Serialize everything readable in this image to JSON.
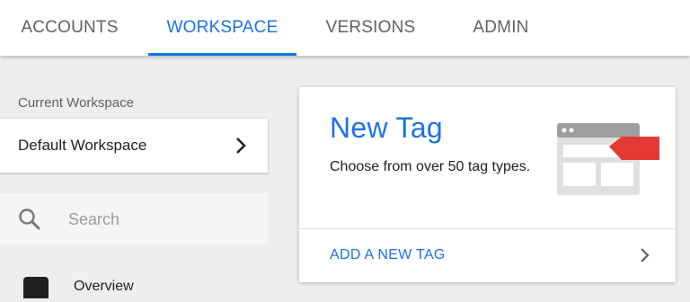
{
  "tabs": {
    "accounts": "ACCOUNTS",
    "workspace": "WORKSPACE",
    "versions": "VERSIONS",
    "admin": "ADMIN",
    "active": "workspace"
  },
  "sidebar": {
    "current_workspace_label": "Current Workspace",
    "workspace_name": "Default Workspace",
    "search_placeholder": "Search",
    "nav_items": [
      {
        "label": "Overview",
        "icon": "briefcase-icon"
      }
    ]
  },
  "new_tag_card": {
    "title": "New Tag",
    "description": "Choose from over 50 tag types.",
    "action_label": "ADD A NEW TAG",
    "illustration": "tag-browser-illustration"
  },
  "colors": {
    "accent": "#1a73e8",
    "tag_red": "#e53935",
    "background": "#eeeeee"
  }
}
